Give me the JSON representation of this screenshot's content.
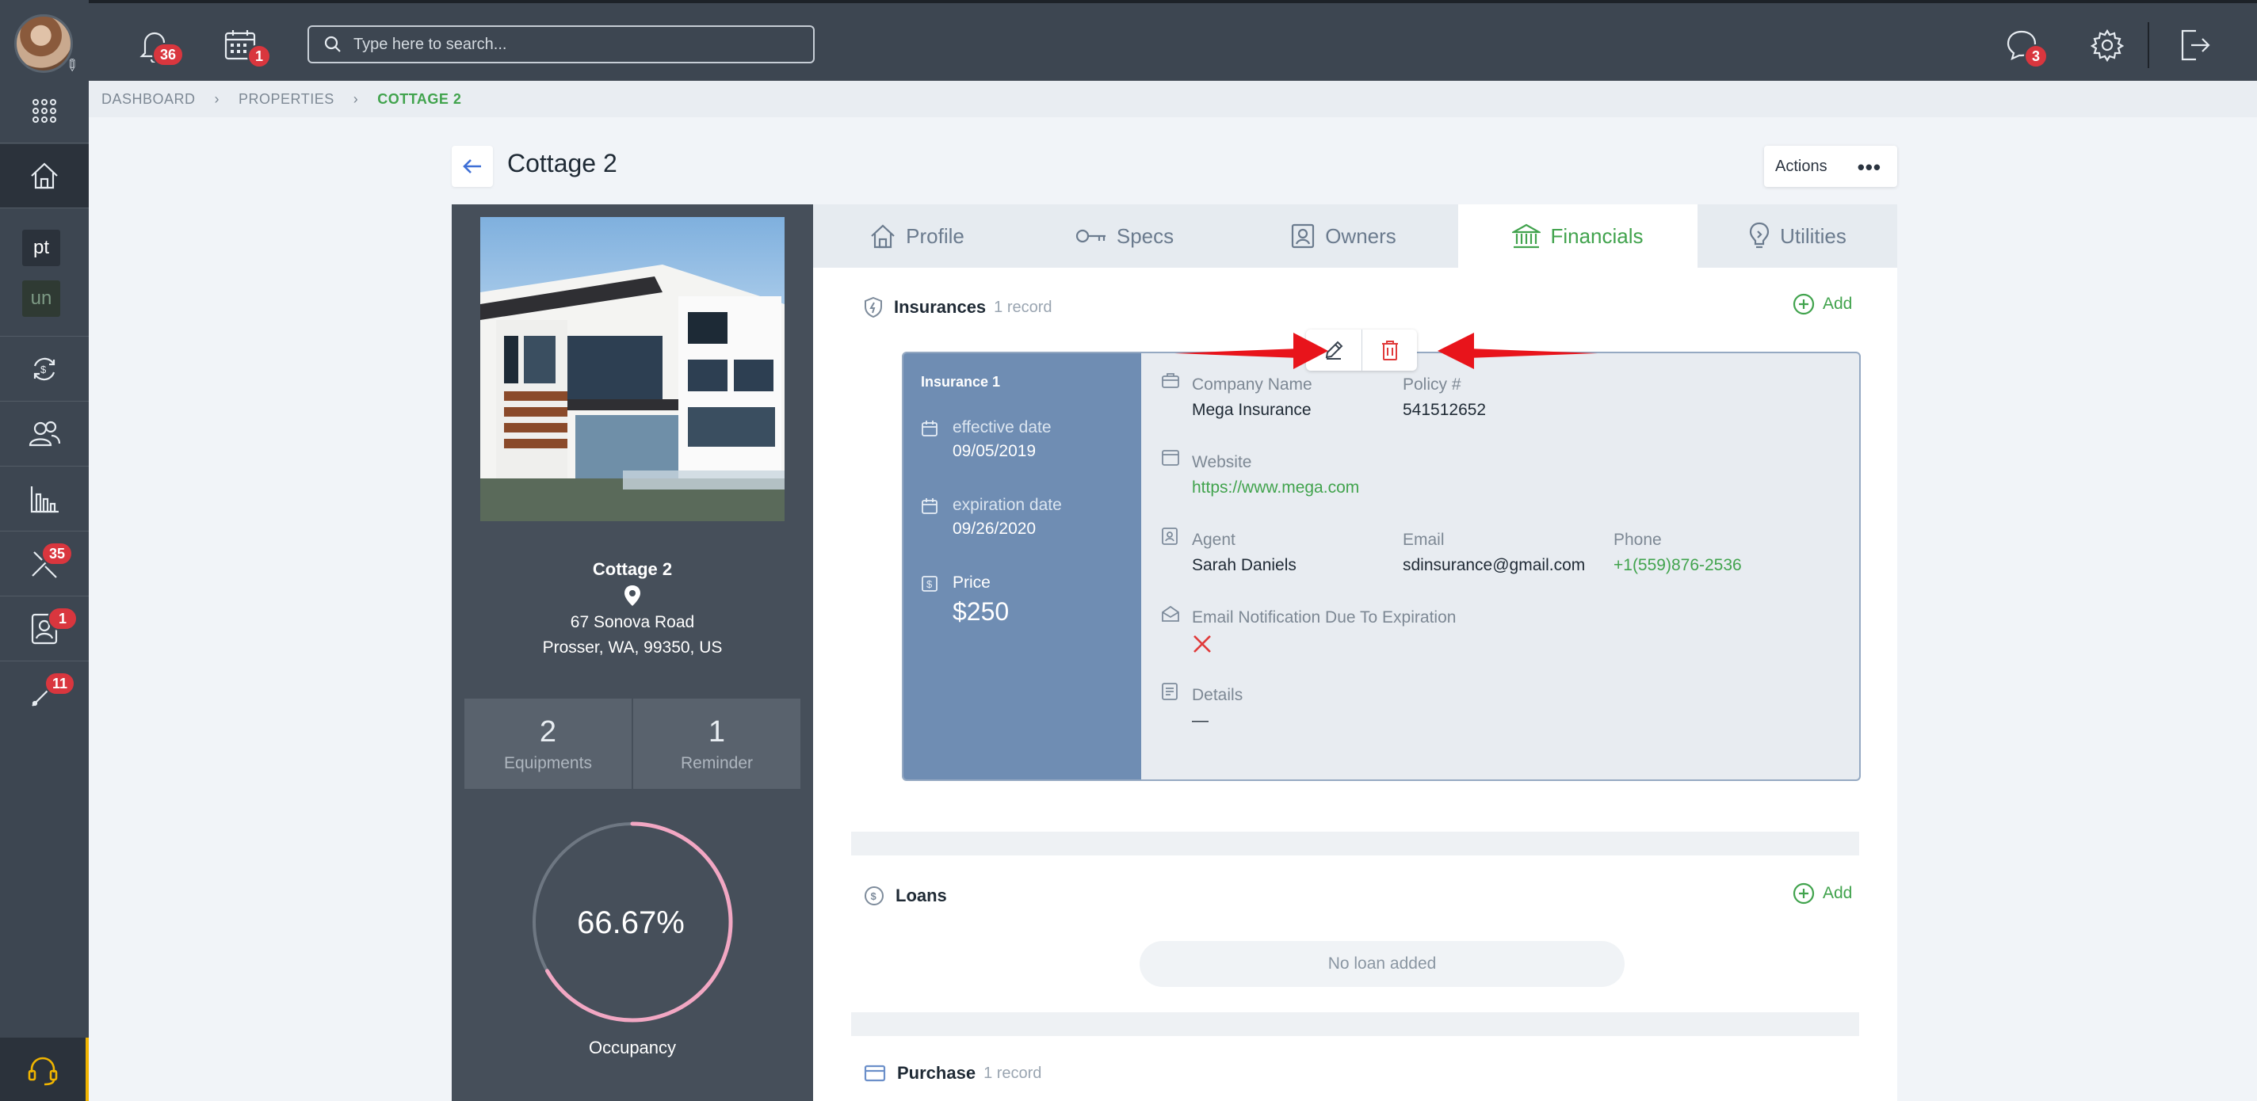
{
  "sidebar": {
    "badges": {
      "tools": "35",
      "contacts": "1",
      "tasks": "11"
    },
    "text_items": [
      "pt",
      "un"
    ]
  },
  "topbar": {
    "notifications_badge": "36",
    "calendar_badge": "1",
    "search_placeholder": "Type here to search...",
    "messages_badge": "3"
  },
  "breadcrumb": [
    "DASHBOARD",
    "PROPERTIES",
    "COTTAGE 2"
  ],
  "page": {
    "title": "Cottage 2",
    "actions_label": "Actions"
  },
  "property": {
    "name": "Cottage 2",
    "address_line1": "67 Sonova Road",
    "address_line2": "Prosser, WA, 99350, US",
    "stats": [
      {
        "value": "2",
        "label": "Equipments"
      },
      {
        "value": "1",
        "label": "Reminder"
      }
    ],
    "occupancy_text": "66.67%",
    "occupancy_fraction": 0.6667,
    "occupancy_label": "Occupancy"
  },
  "tabs": [
    "Profile",
    "Specs",
    "Owners",
    "Financials",
    "Utilities"
  ],
  "active_tab": "Financials",
  "insurances": {
    "title": "Insurances",
    "count": "1 record",
    "add_label": "Add",
    "card": {
      "title": "Insurance 1",
      "effective_label": "effective date",
      "effective_value": "09/05/2019",
      "expiration_label": "expiration date",
      "expiration_value": "09/26/2020",
      "price_label": "Price",
      "price_value": "$250",
      "company_label": "Company Name",
      "company_value": "Mega Insurance",
      "policy_label": "Policy #",
      "policy_value": "541512652",
      "website_label": "Website",
      "website_value": "https://www.mega.com",
      "agent_label": "Agent",
      "agent_value": "Sarah Daniels",
      "email_label": "Email",
      "email_value": "sdinsurance@gmail.com",
      "phone_label": "Phone",
      "phone_value": "+1(559)876-2536",
      "notify_label": "Email Notification Due To Expiration",
      "details_label": "Details",
      "details_value": "—"
    }
  },
  "loans": {
    "title": "Loans",
    "add_label": "Add",
    "empty_text": "No loan added"
  },
  "purchase": {
    "title": "Purchase",
    "count": "1 record"
  },
  "colors": {
    "accent_green": "#41a34d",
    "sidebar_bg": "#3d4651",
    "badge_red": "#d9363e",
    "card_blue": "#6f8db3",
    "annotation_red": "#e8141b",
    "occupancy_ring": "#f2a7c3"
  }
}
